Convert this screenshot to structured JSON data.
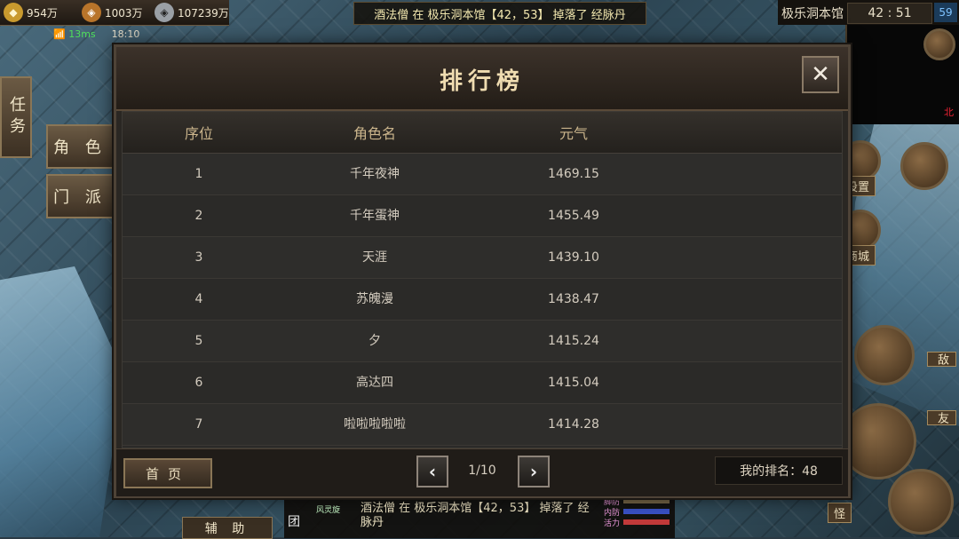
{
  "hud": {
    "gold": "954万",
    "coins": "1003万",
    "silver": "107239万",
    "ping": "13ms",
    "time": "18:10",
    "announcement": "酒法僧 在 极乐洞本馆【42，53】 掉落了 经脉丹",
    "map_name": "极乐洞本馆",
    "coords": "42 : 51",
    "level_badge": "59",
    "north": "北",
    "mini_label": "设置"
  },
  "left_menu": {
    "task": "任务",
    "role": "角 色",
    "sect": "门 派"
  },
  "right_menu": {
    "settings": "设置",
    "shop": "商城",
    "enemy": "敌",
    "friend": "友",
    "monster": "怪"
  },
  "bottom": {
    "assist": "辅 助",
    "chat_message": "酒法僧 在 极乐洞本馆【42，53】 掉落了 经脉丹",
    "team_label": "团",
    "skill_name": "风灵旋",
    "bars": [
      "脚防",
      "内防",
      "活力"
    ]
  },
  "ranking": {
    "title": "排行榜",
    "close_icon": "close-x-icon",
    "columns": [
      "序位",
      "角色名",
      "元气"
    ],
    "rows": [
      {
        "rank": "1",
        "name": "千年夜神",
        "value": "1469.15"
      },
      {
        "rank": "2",
        "name": "千年蛋神",
        "value": "1455.49"
      },
      {
        "rank": "3",
        "name": "天涯",
        "value": "1439.10"
      },
      {
        "rank": "4",
        "name": "苏魄漫",
        "value": "1438.47"
      },
      {
        "rank": "5",
        "name": "夕",
        "value": "1415.24"
      },
      {
        "rank": "6",
        "name": "高达四",
        "value": "1415.04"
      },
      {
        "rank": "7",
        "name": "啦啦啦啦啦",
        "value": "1414.28"
      }
    ],
    "home_button": "首页",
    "page_indicator": "1/10",
    "my_rank": "我的排名：48"
  }
}
